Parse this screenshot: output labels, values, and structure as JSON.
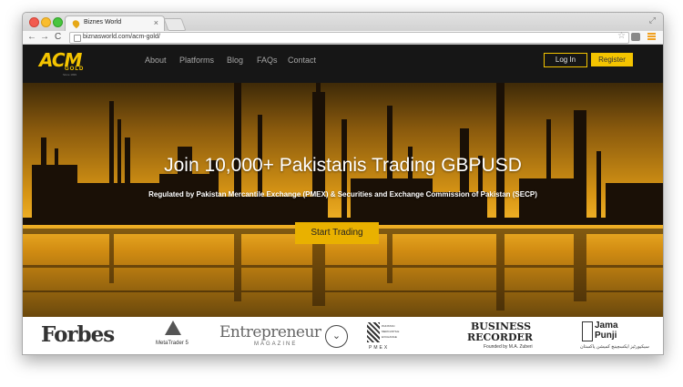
{
  "browser": {
    "tab_title": "Biznes World",
    "tab_close": "×",
    "url": "biznasworld.com/acm-gold/",
    "back_glyph": "←",
    "forward_glyph": "→",
    "reload_glyph": "C",
    "star_glyph": "☆",
    "resize_glyph": "⤢"
  },
  "site": {
    "logo": {
      "main": "ACM",
      "sub": "GOLD",
      "tag": "Since 1999"
    },
    "nav": [
      "About",
      "Platforms",
      "Blog",
      "FAQs",
      "Contact"
    ],
    "login": "Log In",
    "register": "Register"
  },
  "hero": {
    "title": "Join 10,000+ Pakistanis Trading GBPUSD",
    "subtitle": "Regulated by Pakistan Mercantile Exchange (PMEX) & Securities and Exchange Commission of Pakistan (SECP)",
    "cta": "Start Trading"
  },
  "partners": {
    "forbes": "Forbes",
    "metatrader": "MetaTrader 5",
    "entrepreneur": "Entrepreneur",
    "entrepreneur_sub": "MAGAZINE",
    "scroll_glyph": "⌄",
    "pmex_lines": [
      "PAKISTAN",
      "MERCANTILE",
      "EXCHANGE"
    ],
    "pmex_bottom": "PMEX",
    "business_recorder_1": "BUSINESS",
    "business_recorder_2": "RECORDER",
    "business_recorder_sub": "Founded by M.A. Zuberi",
    "jama_1": "Jama",
    "jama_2": "Punji",
    "jama_sub": "سیکیورٹیز ایکسچینج کمیشن پاکستان"
  },
  "colors": {
    "accent": "#f4c400",
    "nav_bg": "#161616",
    "cta_bg": "#e9b100"
  }
}
